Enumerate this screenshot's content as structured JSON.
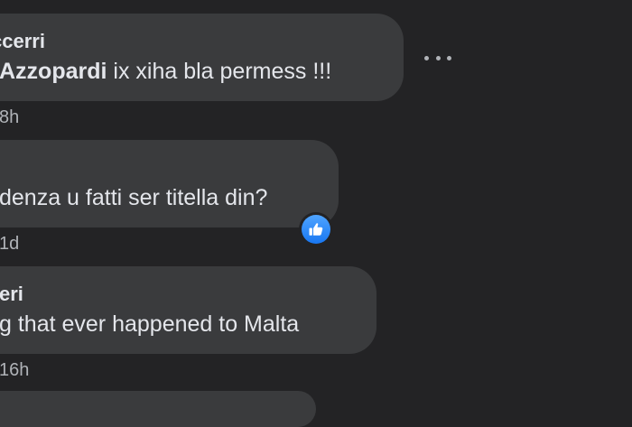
{
  "comments": [
    {
      "author": "ccerri",
      "mention": "Azzopardi",
      "text": " ix xiha bla permess !!!",
      "time": "8h"
    },
    {
      "author": "",
      "text": "denza u fatti ser titella din?",
      "time": "1d",
      "reaction": "like-icon"
    },
    {
      "author": "eri",
      "text": "g that ever happened to Malta",
      "time": "16h"
    }
  ],
  "colors": {
    "background": "#232325",
    "bubble": "#3a3b3d",
    "text": "#e4e6eb",
    "secondary_text": "#b0b3b8",
    "like": "#1877f2"
  }
}
